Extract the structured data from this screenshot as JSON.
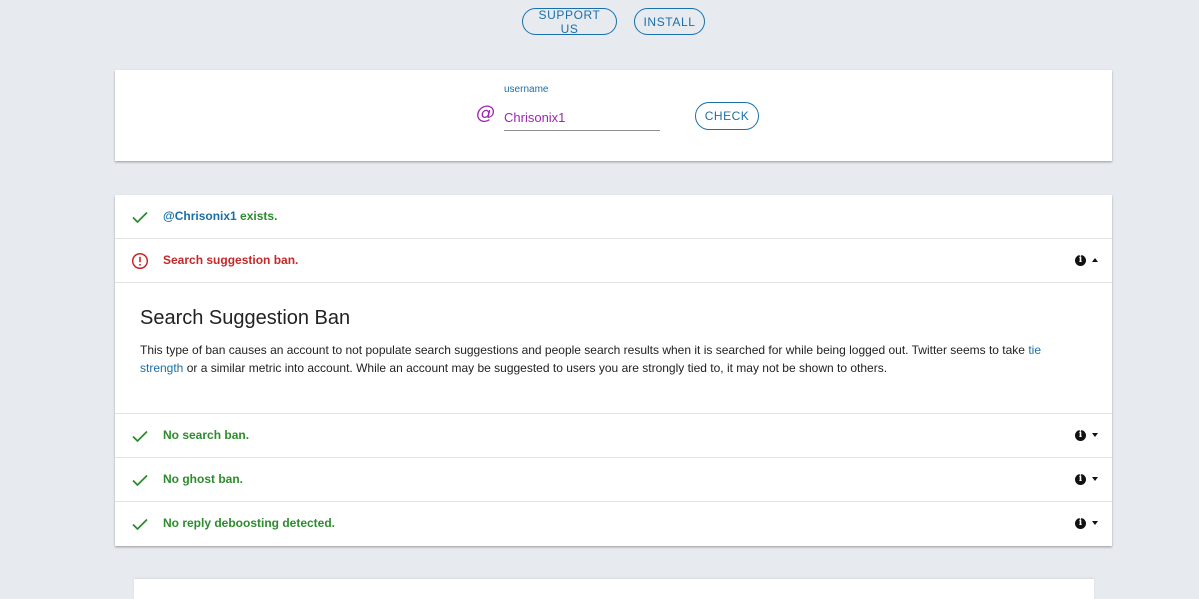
{
  "top_nav": {
    "support_label": "SUPPORT US",
    "install_label": "INSTALL"
  },
  "form": {
    "field_label": "username",
    "at_symbol": "@",
    "username_value": "Chrisonix1",
    "check_label": "CHECK"
  },
  "results": {
    "exists": {
      "user": "@Chrisonix1",
      "suffix": " exists.",
      "status": "ok",
      "icon": "check-icon"
    },
    "suggestion_ban": {
      "text": "Search suggestion ban.",
      "status": "bad",
      "icon": "alert-circle-icon",
      "expanded": true
    },
    "detail": {
      "title": "Search Suggestion Ban",
      "body_before": "This type of ban causes an account to not populate search suggestions and people search results when it is searched for while being logged out. Twitter seems to take ",
      "link_text": "tie strength",
      "body_after": " or a similar metric into account. While an account may be suggested to users you are strongly tied to, it may not be shown to others."
    },
    "search_ban": {
      "text": "No search ban.",
      "status": "ok",
      "icon": "check-icon"
    },
    "ghost_ban": {
      "text": "No ghost ban.",
      "status": "ok",
      "icon": "check-icon"
    },
    "reply_deboosting": {
      "text": "No reply deboosting detected.",
      "status": "ok",
      "icon": "check-icon"
    }
  },
  "colors": {
    "accent": "#1b6fa8",
    "ok": "#2e8b2e",
    "bad": "#c62828",
    "username": "#9c27b0",
    "background": "#e7ebf0"
  }
}
